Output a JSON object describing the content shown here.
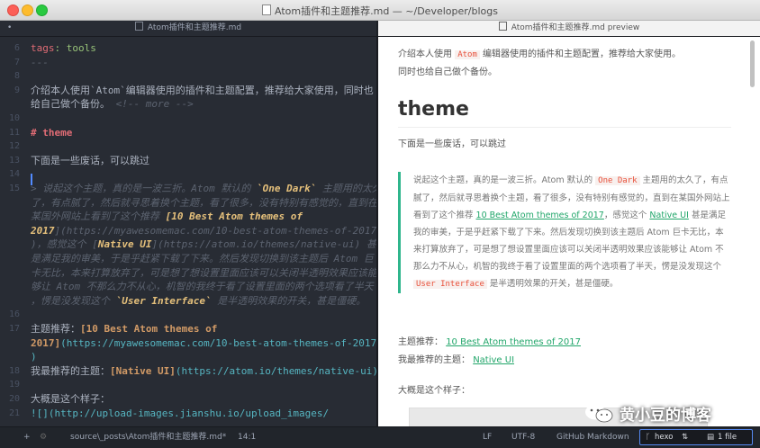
{
  "window": {
    "title": "Atom插件和主题推荐.md — ~/Developer/blogs"
  },
  "tabs": [
    {
      "label": "Atom插件和主题推荐.md"
    },
    {
      "label": "Atom插件和主题推荐.md preview"
    }
  ],
  "editor": {
    "lines": [
      {
        "n": "6",
        "parts": [
          {
            "t": "tags",
            "c": "tagk"
          },
          {
            "t": ": tools",
            "c": "tagv"
          }
        ]
      },
      {
        "n": "7",
        "parts": [
          {
            "t": "---",
            "c": "comment"
          }
        ]
      },
      {
        "n": "8",
        "parts": []
      },
      {
        "n": "9",
        "parts": [
          {
            "t": "介绍本人使用`Atom`编辑器使用的插件和主题配置，推荐给大家使用，同时也",
            "c": ""
          }
        ]
      },
      {
        "n": "",
        "parts": [
          {
            "t": "给自己做个备份。 ",
            "c": ""
          },
          {
            "t": "<!-- more -->",
            "c": "comment"
          }
        ]
      },
      {
        "n": "10",
        "parts": []
      },
      {
        "n": "11",
        "parts": [
          {
            "t": "# theme",
            "c": "heading"
          }
        ]
      },
      {
        "n": "12",
        "parts": []
      },
      {
        "n": "13",
        "parts": [
          {
            "t": "下面是一些废话，可以跳过",
            "c": ""
          }
        ]
      },
      {
        "n": "14",
        "parts": []
      },
      {
        "n": "15",
        "parts": [
          {
            "t": "> 说起这个主题，真的是一波三折。Atom 默认的 ",
            "c": "quote"
          },
          {
            "t": "`One Dark`",
            "c": "linktxt"
          },
          {
            "t": " 主题用的太久",
            "c": "quote"
          }
        ]
      },
      {
        "n": "",
        "parts": [
          {
            "t": "了，有点腻了，然后就寻思着换个主题，看了很多，没有特别有感觉的，直到在",
            "c": "quote"
          }
        ]
      },
      {
        "n": "",
        "parts": [
          {
            "t": "某国外网站上看到了这个推荐 ",
            "c": "quote"
          },
          {
            "t": "[10 Best Atom themes of",
            "c": "linktxt"
          }
        ]
      },
      {
        "n": "",
        "parts": [
          {
            "t": "2017",
            "c": "linktxt"
          },
          {
            "t": "](https://myawesomemac.com/10-best-atom-themes-of-2017/",
            "c": "quote"
          }
        ]
      },
      {
        "n": "",
        "parts": [
          {
            "t": ")，感觉这个 [",
            "c": "quote"
          },
          {
            "t": "Native UI",
            "c": "linktxt"
          },
          {
            "t": "](https://atom.io/themes/native-ui) 甚",
            "c": "quote"
          }
        ]
      },
      {
        "n": "",
        "parts": [
          {
            "t": "是满足我的审美，于是乎赶紧下载了下来。然后发现切换到该主题后 Atom 巨",
            "c": "quote"
          }
        ]
      },
      {
        "n": "",
        "parts": [
          {
            "t": "卡无比，本来打算放弃了，可是想了想设置里面应该可以关闭半透明效果应该能",
            "c": "quote"
          }
        ]
      },
      {
        "n": "",
        "parts": [
          {
            "t": "够让 Atom 不那么力不从心，机智的我终于看了设置里面的两个选项看了半天",
            "c": "quote"
          }
        ]
      },
      {
        "n": "",
        "parts": [
          {
            "t": "，愣是没发现这个 ",
            "c": "quote"
          },
          {
            "t": "`User Interface`",
            "c": "linktxt"
          },
          {
            "t": " 是半透明效果的开关，甚是僵硬。",
            "c": "quote"
          }
        ]
      },
      {
        "n": "16",
        "parts": []
      },
      {
        "n": "17",
        "parts": [
          {
            "t": "主题推荐：",
            "c": ""
          },
          {
            "t": "[10 Best Atom themes of",
            "c": "strong"
          }
        ]
      },
      {
        "n": "",
        "parts": [
          {
            "t": "2017]",
            "c": "strong"
          },
          {
            "t": "(https://myawesomemac.com/10-best-atom-themes-of-2017/",
            "c": "link"
          }
        ]
      },
      {
        "n": "",
        "parts": [
          {
            "t": ")",
            "c": "link"
          }
        ]
      },
      {
        "n": "18",
        "parts": [
          {
            "t": "我最推荐的主题：",
            "c": ""
          },
          {
            "t": "[Native UI]",
            "c": "strong"
          },
          {
            "t": "(https://atom.io/themes/native-ui)",
            "c": "link"
          }
        ]
      },
      {
        "n": "19",
        "parts": []
      },
      {
        "n": "20",
        "parts": [
          {
            "t": "大概是这个样子：",
            "c": ""
          }
        ]
      },
      {
        "n": "21",
        "parts": [
          {
            "t": "![](http://upload-images.jianshu.io/upload_images/",
            "c": "link"
          }
        ]
      }
    ]
  },
  "preview": {
    "intro_a": "介绍本人使用 ",
    "intro_code": "Atom",
    "intro_b": " 编辑器使用的插件和主题配置，推荐给大家使用。",
    "intro_c": "同时也给自己做个备份。",
    "h1": "theme",
    "p1": "下面是一些废话，可以跳过",
    "bq_a": "说起这个主题，真的是一波三折。Atom 默认的 ",
    "bq_code1": "One Dark",
    "bq_b": " 主题用的太久了，有点腻了，然后就寻思着换个主题，看了很多，没有特别有感觉的，直到在某国外网站上看到了这个推荐 ",
    "bq_link1": "10 Best Atom themes of 2017",
    "bq_c": "，感觉这个 ",
    "bq_link2": "Native UI",
    "bq_d": " 甚是满足我的审美，于是乎赶紧下载了下来。然后发现切换到该主题后 Atom 巨卡无比，本来打算放弃了，可是想了想设置里面应该可以关闭半透明效果应该能够让 Atom 不那么力不从心，机智的我终于看了设置里面的两个选项看了半天，愣是没发现这个 ",
    "bq_code2": "User Interface",
    "bq_e": " 是半透明效果的开关，甚是僵硬。",
    "rec_label": "主题推荐：",
    "rec_link": "10 Best Atom themes of 2017",
    "fav_label": "我最推荐的主题：",
    "fav_link": "Native UI",
    "p_last": "大概是这个样子："
  },
  "status": {
    "add": "+",
    "path": "source\\_posts\\Atom插件和主题推荐.md*",
    "cursor": "14:1",
    "line_ending": "LF",
    "encoding": "UTF-8",
    "grammar": "GitHub Markdown",
    "branch": "hexo",
    "files": "1 file"
  },
  "watermark": {
    "text": "黄小豆的博客"
  }
}
